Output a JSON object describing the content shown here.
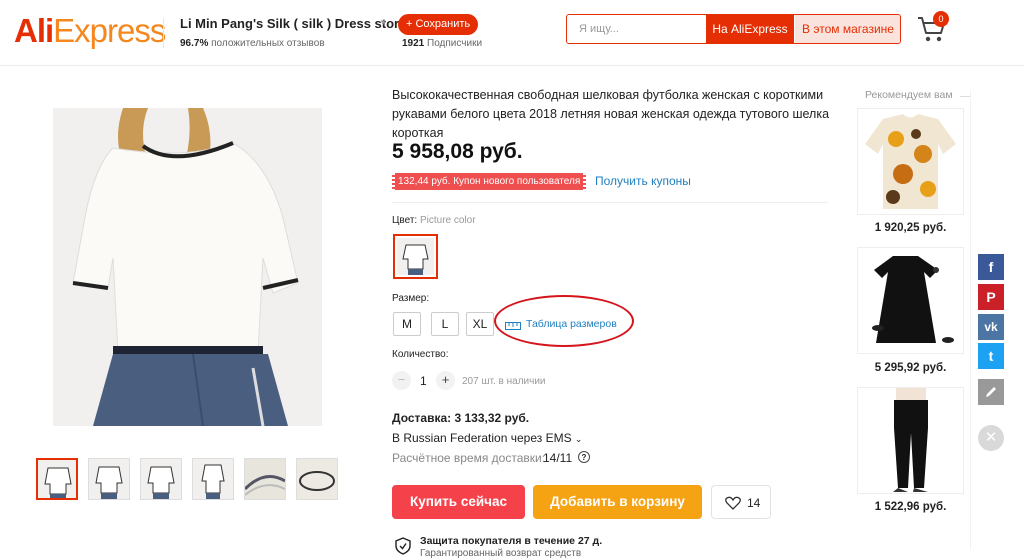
{
  "header": {
    "logo_ali": "Ali",
    "logo_express": "Express",
    "store_name": "Li Min Pang's Silk ( silk ) Dress store",
    "save_label": "+ Сохранить",
    "rating_value": "96.7%",
    "rating_text": "положительных отзывов",
    "subs_value": "1921",
    "subs_text": "Подписчики",
    "search_placeholder": "Я ищу...",
    "btn_aliexpress": "На AliExpress",
    "btn_store": "В этом магазине",
    "cart_count": "0"
  },
  "product": {
    "title": "Высококачественная свободная шелковая футболка женская с короткими рукавами белого цвета 2018 летняя новая женская одежда тутового шелка короткая",
    "price": "5 958,08 руб.",
    "coupon_text": "132,44 руб. Купон нового пользователя",
    "get_coupons": "Получить купоны",
    "color_label": "Цвет:",
    "color_value": "Picture color",
    "size_label": "Размер:",
    "sizes": [
      "M",
      "L",
      "XL"
    ],
    "size_chart": "Таблица размеров",
    "qty_label": "Количество:",
    "qty_value": "1",
    "qty_minus": "−",
    "qty_plus": "+",
    "qty_available": "207 шт. в наличии",
    "shipping_cost": "Доставка: 3 133,32 руб.",
    "shipping_via": "В Russian Federation через EMS",
    "shipping_time_label": "Расчётное время доставки:",
    "shipping_time_value": "14/11",
    "help_glyph": "?",
    "buy_now": "Купить сейчас",
    "add_to_cart": "Добавить в корзину",
    "wishlist_count": "14",
    "protection_title": "Защита покупателя в течение 27 д.",
    "protection_sub": "Гарантированный возврат средств"
  },
  "recommend": {
    "title": "Рекомендуем вам",
    "items": [
      {
        "price": "1 920,25 руб."
      },
      {
        "price": "5 295,92 руб."
      },
      {
        "price": "1 522,96 руб."
      }
    ]
  },
  "social": {
    "facebook": "f",
    "pinterest": "P",
    "vk": "vk",
    "twitter": "t",
    "close": "✕"
  },
  "colors": {
    "accent": "#e62e04",
    "buy": "#f5424a",
    "cart": "#f5a213",
    "link": "#2080c0",
    "facebook": "#3b5998",
    "pinterest": "#cb2027",
    "vk": "#4c75a3",
    "twitter": "#1da1f2"
  }
}
